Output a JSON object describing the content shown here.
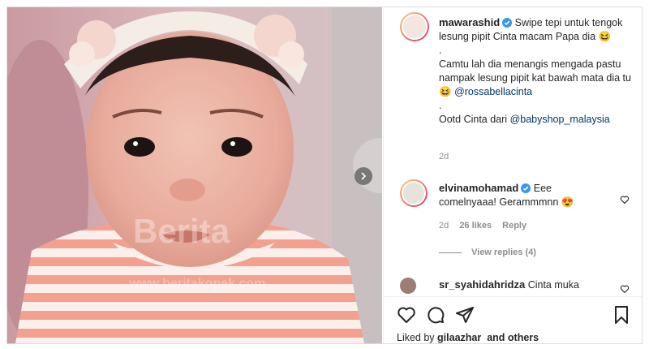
{
  "post": {
    "author": "mawarashid",
    "caption_lines": [
      "Swipe tepi untuk tengok lesung pipit Cinta macam Papa dia 😆",
      ".",
      "Camtu lah dia menangis mengada pastu nampak lesung pipit kat bawah mata dia tu 😆",
      ".",
      "Ootd Cinta dari"
    ],
    "mention_1": "@rossabellacinta",
    "mention_2": "@babyshop_malaysia",
    "age": "2d"
  },
  "comments": [
    {
      "user": "elvinamohamad",
      "text": "Eee comelnyaaa! Gerammmnn 😍",
      "age": "2d",
      "likes": "26 likes",
      "reply": "Reply",
      "view_replies": "View replies (4)"
    },
    {
      "user": "sr_syahidahridza",
      "text": "Cinta muka"
    }
  ],
  "footer": {
    "liked_by_prefix": "Liked by",
    "liked_by_user": "gilaazhar",
    "and_others": "and others"
  },
  "icons": {
    "like": "heart-icon",
    "comment": "comment-icon",
    "share": "paper-plane-icon",
    "save": "bookmark-icon",
    "next": "chevron-right-icon"
  },
  "colors": {
    "verified": "#3897f0",
    "mention": "#00376b",
    "meta": "#8e8e8e"
  }
}
